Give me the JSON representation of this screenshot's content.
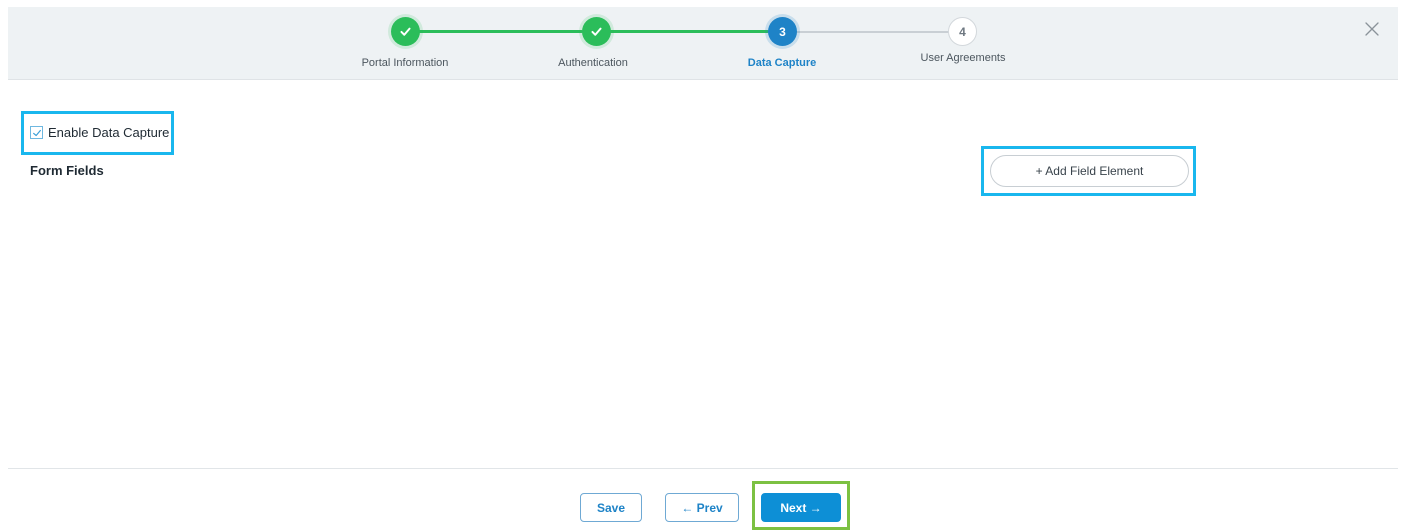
{
  "wizard": {
    "steps": [
      {
        "number": "1",
        "label": "Portal Information",
        "state": "complete"
      },
      {
        "number": "2",
        "label": "Authentication",
        "state": "complete"
      },
      {
        "number": "3",
        "label": "Data Capture",
        "state": "active"
      },
      {
        "number": "4",
        "label": "User Agreements",
        "state": "pending"
      }
    ],
    "close_icon": "close-icon"
  },
  "content": {
    "enable_data_capture_label": "Enable Data Capture",
    "enable_data_capture_checked": true,
    "form_fields_label": "Form Fields",
    "add_field_button_label": "+ Add Field Element"
  },
  "footer": {
    "save_label": "Save",
    "prev_label": "← Prev",
    "next_label": "Next →"
  },
  "colors": {
    "complete": "#2bbd5a",
    "active": "#1e83c7",
    "highlight_blue": "#19b7ee",
    "highlight_green": "#7cc142",
    "primary_button": "#0d8fd6"
  }
}
